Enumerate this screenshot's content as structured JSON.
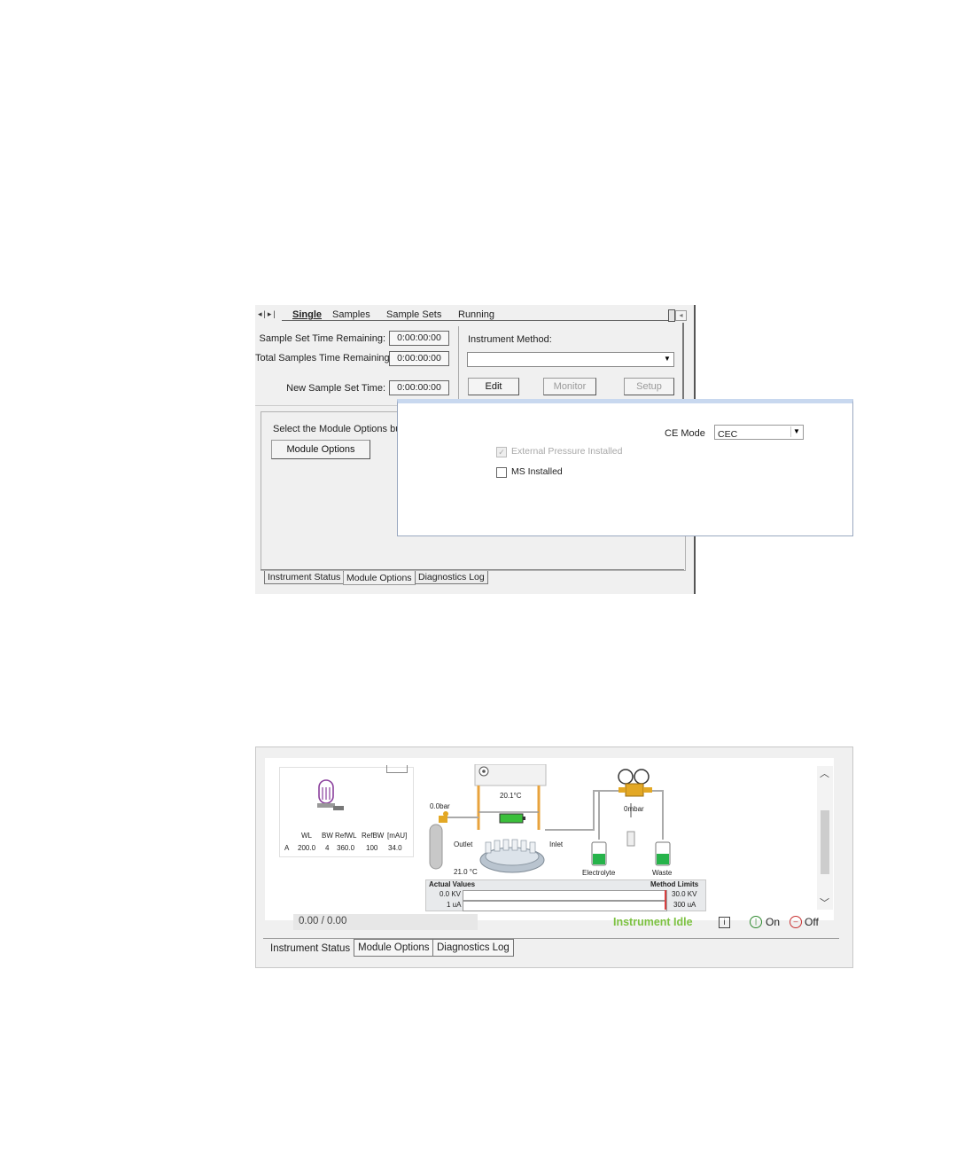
{
  "shot1": {
    "tabs": [
      "Single",
      "Samples",
      "Sample Sets",
      "Running"
    ],
    "active_tab": "Single",
    "sample_set_time_label": "Sample Set Time Remaining:",
    "sample_set_time_value": "0:00:00:00",
    "total_samples_label": "Total Samples Time Remaining:",
    "total_samples_value": "0:00:00:00",
    "new_sample_set_label": "New Sample Set Time:",
    "new_sample_set_value": "0:00:00:00",
    "instrument_method_label": "Instrument Method:",
    "instrument_method_value": "",
    "edit_button": "Edit",
    "monitor_button": "Monitor",
    "setup_button": "Setup",
    "module_options_hint": "Select the Module Options but",
    "module_options_button": "Module Options",
    "bottom_tabs": [
      "Instrument Status",
      "Module Options",
      "Diagnostics Log"
    ],
    "bottom_active_tab": "Module Options",
    "popup": {
      "ce_mode_label": "CE Mode",
      "ce_mode_value": "CEC",
      "external_pressure_label": "External Pressure Installed",
      "external_pressure_checked": true,
      "external_pressure_enabled": false,
      "ms_installed_label": "MS Installed",
      "ms_installed_checked": false
    }
  },
  "shot2": {
    "detector_table": {
      "headers": [
        "WL",
        "BW",
        "RefWL",
        "RefBW",
        "[mAU]"
      ],
      "row_label": "A",
      "values": [
        "200.0",
        "4",
        "360.0",
        "100",
        "34.0"
      ]
    },
    "pressure_left": "0.0bar",
    "cassette_temp": "20.1°C",
    "pressure_right": "0mbar",
    "outlet_label": "Outlet",
    "inlet_label": "Inlet",
    "tray_temp": "21.0 °C",
    "electrolyte_label": "Electrolyte",
    "waste_label": "Waste",
    "actual_values_label": "Actual Values",
    "method_limits_label": "Method Limits",
    "actual_kv": "0.0 KV",
    "actual_ua": "1 uA",
    "limit_kv": "30.0 KV",
    "limit_ua": "300 uA",
    "progress_text": "0.00 / 0.00",
    "status_text": "Instrument Idle",
    "status_color": "#7dc242",
    "info_icon": "i",
    "on_label": "On",
    "off_label": "Off",
    "bottom_tabs": [
      "Instrument Status",
      "Module Options",
      "Diagnostics Log"
    ],
    "bottom_active_tab": "Instrument Status"
  }
}
